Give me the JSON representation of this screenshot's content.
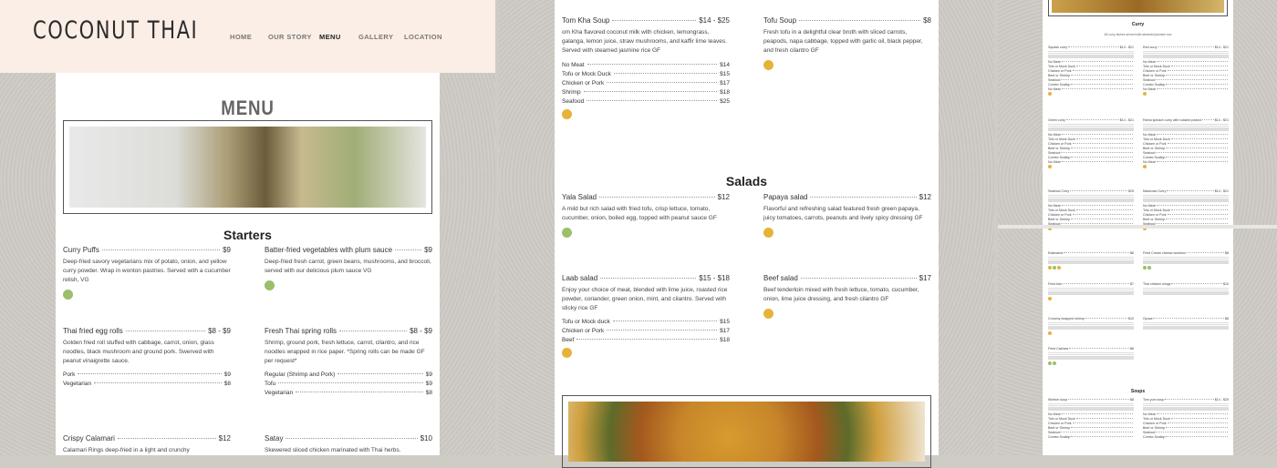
{
  "site": {
    "logo": "COCONUT THAI",
    "nav": [
      "HOME",
      "OUR STORY",
      "MENU",
      "GALLERY",
      "LOCATION"
    ],
    "active_nav": "MENU",
    "page_title": "MENU"
  },
  "starters": {
    "heading": "Starters",
    "curry_puffs": {
      "name": "Curry Puffs",
      "price": "$9",
      "desc": "Deep-fried savory vegetarians mix of potato, onion, and yellow curry powder. Wrap in wonton pastries. Served with a cucumber relish, VG"
    },
    "batter_veg": {
      "name": "Batter-fried vegetables with plum sauce",
      "price": "$9",
      "desc": "Deep-fried fresh carrot, green beans, mushrooms, and broccoli, served with our delicious plum sauce VG"
    },
    "egg_rolls": {
      "name": "Thai fried egg rolls",
      "price": "$8 - $9",
      "desc": "Golden fried roll stuffed with cabbage, carrot, onion, glass noodles, black mushroom and ground pork. Swerved with peanut vinaigrette sauce.",
      "options": [
        {
          "name": "Pork",
          "price": "$9"
        },
        {
          "name": "Vegetarian",
          "price": "$8"
        }
      ]
    },
    "spring_rolls": {
      "name": "Fresh Thai spring rolls",
      "price": "$8 - $9",
      "desc": "Shrimp, ground pork, fresh lettuce, carrot, cilantro, and rice noodles wrapped in rice paper. *Spring rolls can be made GF per request*",
      "options": [
        {
          "name": "Regular (Shrimp and Pork)",
          "price": "$9"
        },
        {
          "name": "Tofu",
          "price": "$9"
        },
        {
          "name": "Vegetarian",
          "price": "$8"
        }
      ]
    },
    "calamari": {
      "name": "Crispy Calamari",
      "price": "$12",
      "desc": "Calamari Rings deep-fried in a light and crunchy"
    },
    "satay": {
      "name": "Satay",
      "price": "$10",
      "desc": "Skewered sliced chicken marinated with Thai herbs."
    }
  },
  "soups": {
    "tom_kha": {
      "name": "Tom Kha Soup",
      "price": "$14 - $25",
      "desc": "om Kha flavored coconut milk with chicken, lemongrass, galanga, lemon juice, straw mushrooms, and kaffir lime leaves. Served with steamed jasmine rice GF",
      "options": [
        {
          "name": "No Meat",
          "price": "$14"
        },
        {
          "name": "Tofu or Mock Duck",
          "price": "$15"
        },
        {
          "name": "Chicken or Pork",
          "price": "$17"
        },
        {
          "name": "Shrimp",
          "price": "$18"
        },
        {
          "name": "Seafood",
          "price": "$25"
        }
      ]
    },
    "tofu_soup": {
      "name": "Tofu Soup",
      "price": "$8",
      "desc": "Fresh tofu in a delightful clear broth with sliced carrots, peapods, napa cabbage, topped with garlic oil, black pepper, and fresh cilantro GF"
    }
  },
  "salads": {
    "heading": "Salads",
    "yala": {
      "name": "Yala Salad",
      "price": "$12",
      "desc": "A mild but rich salad with fried tofu, crisp lettuce, tomato, cucumber, onion, boiled egg, topped with peanut sauce GF"
    },
    "papaya": {
      "name": "Papaya salad",
      "price": "$12",
      "desc": "Flavorful and refreshing salad featured fresh green papaya, juicy tomatoes, carrots, peanuts and lively spicy dressing GF"
    },
    "laab": {
      "name": "Laab salad",
      "price": "$15 - $18",
      "desc": "Enjoy your choice of meat, blended with lime juice, roasted rice powder, coriander, green onion, mint, and cilantro. Served with sticky rice GF",
      "options": [
        {
          "name": "Tofu or Mock duck",
          "price": "$15"
        },
        {
          "name": "Chicken or Pork",
          "price": "$17"
        },
        {
          "name": "Beef",
          "price": "$18"
        }
      ]
    },
    "beef": {
      "name": "Beef salad",
      "price": "$17",
      "desc": "Beef tenderloin mixed with fresh lettuce, tomato, cucumber, onion, lime juice dressing, and fresh cilantro GF"
    }
  },
  "preview": {
    "curry_heading": "Curry",
    "curry_sub": "All curry dishes served with steamed jasmine rice",
    "soups_heading": "Soups",
    "items": [
      {
        "name": "Squash curry",
        "price": "$14 - $21"
      },
      {
        "name": "Red curry",
        "price": "$14 - $21"
      },
      {
        "name": "Green curry",
        "price": "$14 - $21"
      },
      {
        "name": "Rama spinach curry with roasted peanut",
        "price": "$14 - $21"
      },
      {
        "name": "Seafood Curry",
        "price": "$25"
      },
      {
        "name": "Massman Curry",
        "price": "$14 - $21"
      },
      {
        "name": "Edamame",
        "price": "$6"
      },
      {
        "name": "Fried Cream cheese wontons",
        "price": "$8"
      },
      {
        "name": "Fried tofu",
        "price": "$7"
      },
      {
        "name": "Thai chicken wings",
        "price": "$10"
      },
      {
        "name": "Crunchy wrapped shrimp",
        "price": "$10"
      },
      {
        "name": "Gyoza",
        "price": "$8"
      },
      {
        "name": "Fried Cashew",
        "price": "$6"
      },
      {
        "name": "Wonton soup",
        "price": "$8"
      },
      {
        "name": "Tom yum soup",
        "price": "$14 - $25"
      }
    ],
    "options": [
      "No Meat",
      "Tofu or Mock Duck",
      "Chicken or Pork",
      "Beef or Shrimp",
      "Seafood",
      "Combo Scallop"
    ]
  },
  "colors": {
    "vg_badge": "#9bbf6a",
    "gf_badge": "#e6b33a",
    "header_bg": "#fbeee6"
  }
}
